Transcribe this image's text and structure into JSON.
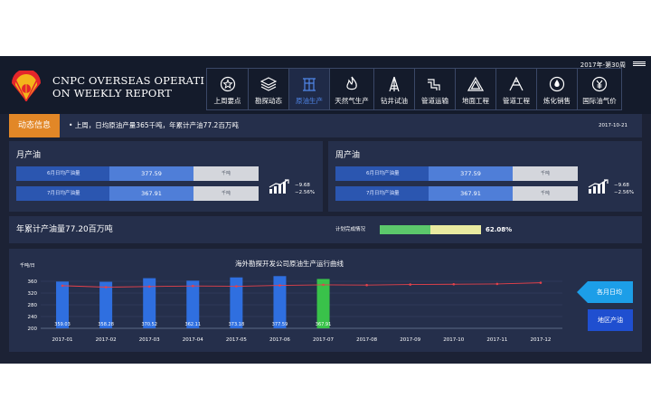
{
  "header": {
    "title_line1": "CNPC OVERSEAS OPERATI",
    "title_line2": "ON WEEKLY REPORT",
    "week": "2017年-第30周"
  },
  "nav": [
    {
      "label": "上周要点",
      "icon": "star-icon",
      "active": false
    },
    {
      "label": "勘探动态",
      "icon": "layers-icon",
      "active": false
    },
    {
      "label": "原油生产",
      "icon": "pump-icon",
      "active": true
    },
    {
      "label": "天然气生产",
      "icon": "flame-icon",
      "active": false
    },
    {
      "label": "钻井试油",
      "icon": "drill-icon",
      "active": false
    },
    {
      "label": "管道运输",
      "icon": "pipe-icon",
      "active": false
    },
    {
      "label": "地面工程",
      "icon": "triangle-icon",
      "active": false
    },
    {
      "label": "管道工程",
      "icon": "pipeline-icon",
      "active": false
    },
    {
      "label": "炼化销售",
      "icon": "drop-icon",
      "active": false
    },
    {
      "label": "国际油气价",
      "icon": "yen-icon",
      "active": false
    }
  ],
  "news": {
    "tag": "动态信息",
    "text": "• 上周，日均原油产量365千吨，年累计产油77.2百万吨",
    "date": "2017-10-21"
  },
  "monthly": {
    "title": "月产油",
    "rows": [
      {
        "label": "6月日均产油量",
        "value": "377.59",
        "unit": "千吨"
      },
      {
        "label": "7月日均产油量",
        "value": "367.91",
        "unit": "千吨"
      }
    ],
    "change_abs": "−9.68",
    "change_pct": "−2.56%"
  },
  "weekly": {
    "title": "周产油",
    "rows": [
      {
        "label": "6月日均产油量",
        "value": "377.59",
        "unit": "千吨"
      },
      {
        "label": "7月日均产油量",
        "value": "367.91",
        "unit": "千吨"
      }
    ],
    "change_abs": "−9.68",
    "change_pct": "−2.56%"
  },
  "annual": {
    "title": "年累计产油量77.20百万吨",
    "plan_label": "计划完成情况",
    "plan_pct": "62.08%",
    "plan_fraction": 0.5
  },
  "buttons": {
    "month_avg": "各月日均",
    "region": "地区产油"
  },
  "colors": {
    "bar": "#2f6fe0",
    "bar_highlight": "#39c24a",
    "line": "#e5414b"
  },
  "chart_data": {
    "type": "bar",
    "title": "海外勘探开发公司原油生产运行曲线",
    "ylabel": "千吨/日",
    "ylim": [
      200,
      360
    ],
    "yticks": [
      200,
      240,
      280,
      320,
      360
    ],
    "categories": [
      "2017-01",
      "2017-02",
      "2017-03",
      "2017-04",
      "2017-05",
      "2017-06",
      "2017-07",
      "2017-08",
      "2017-09",
      "2017-10",
      "2017-11",
      "2017-12"
    ],
    "series": [
      {
        "type": "bar",
        "values": [
          359.03,
          358.28,
          370.52,
          362.11,
          373.18,
          377.59,
          367.91,
          null,
          null,
          null,
          null,
          null
        ],
        "labels": [
          "359.03",
          "358.28",
          "370.52",
          "362.11",
          "373.18",
          "377.59",
          "367.91"
        ]
      },
      {
        "type": "line",
        "values": [
          345,
          340,
          342,
          344,
          343,
          346,
          348,
          347,
          349,
          350,
          351,
          355
        ]
      }
    ],
    "highlight_index": 6
  }
}
